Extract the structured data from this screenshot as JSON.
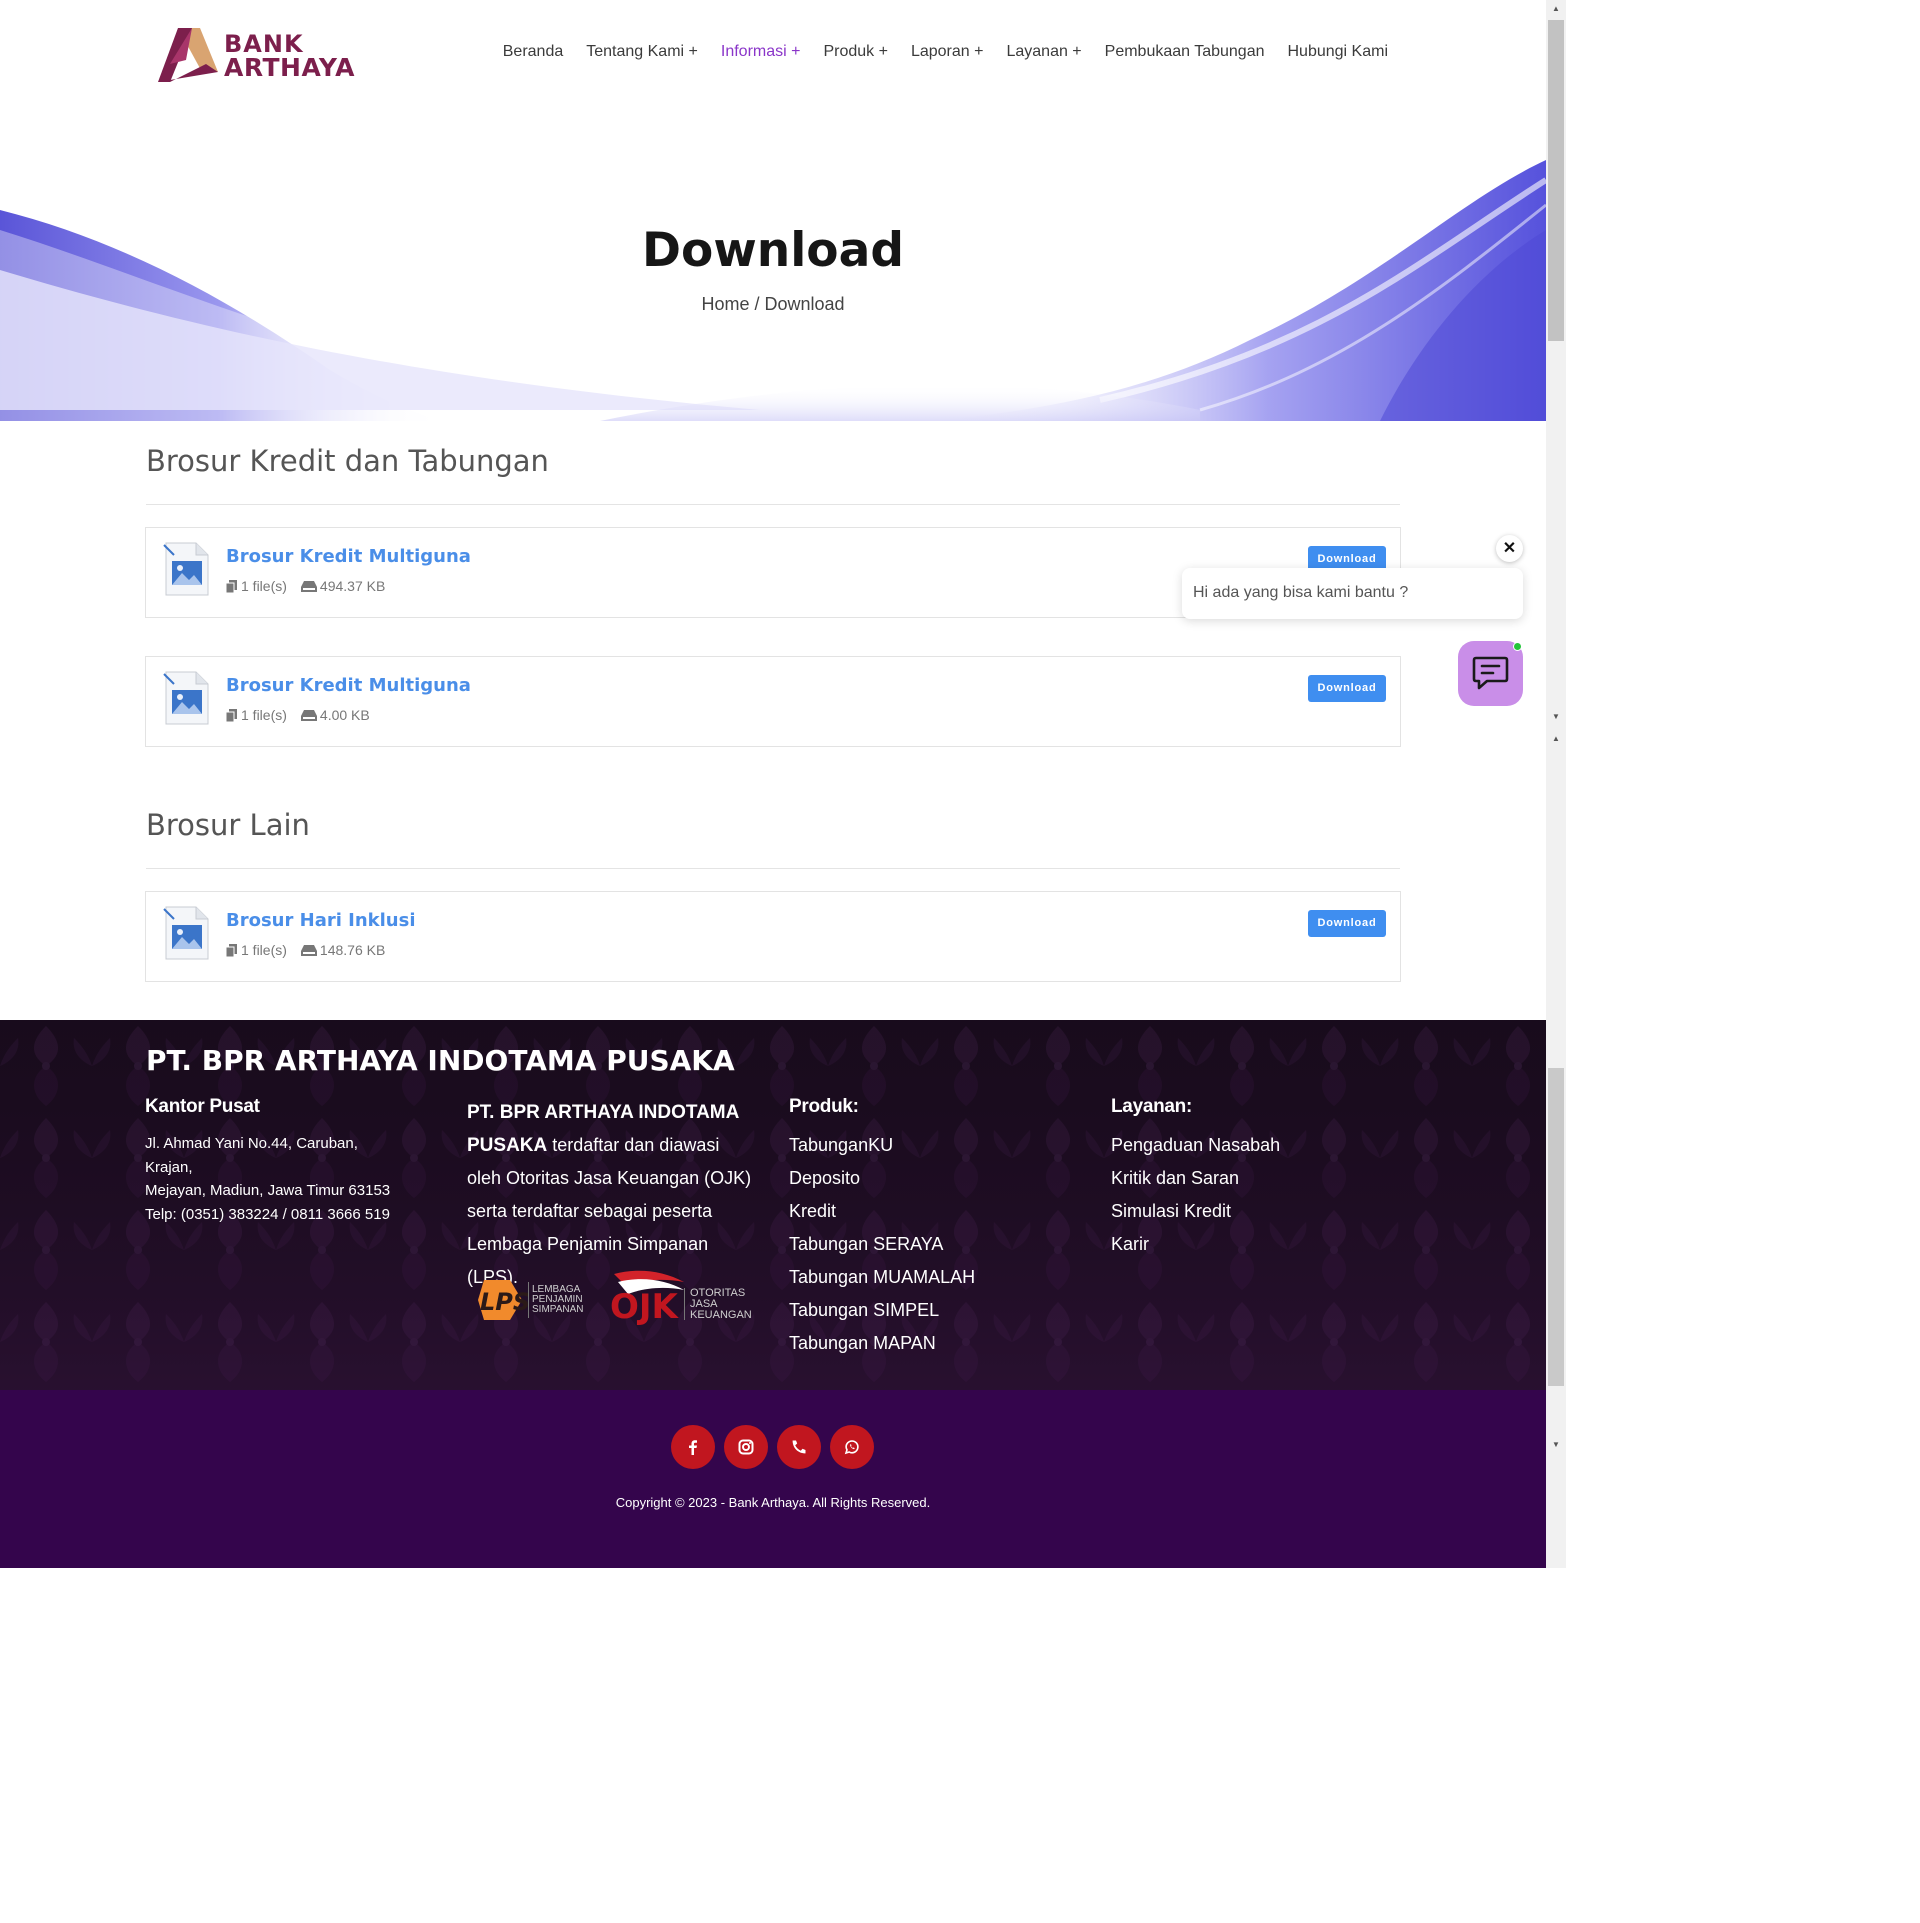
{
  "brand": {
    "line1": "BANK",
    "line2": "ARTHAYA"
  },
  "nav": [
    {
      "label": "Beranda",
      "active": false
    },
    {
      "label": "Tentang Kami +",
      "active": false
    },
    {
      "label": "Informasi +",
      "active": true
    },
    {
      "label": "Produk +",
      "active": false
    },
    {
      "label": "Laporan +",
      "active": false
    },
    {
      "label": "Layanan +",
      "active": false
    },
    {
      "label": "Pembukaan Tabungan",
      "active": false
    },
    {
      "label": "Hubungi Kami",
      "active": false
    }
  ],
  "hero": {
    "title": "Download",
    "breadcrumb_home": "Home",
    "breadcrumb_sep": " / ",
    "breadcrumb_current": "Download"
  },
  "sections": [
    {
      "title": "Brosur Kredit dan Tabungan",
      "files": [
        {
          "title": "Brosur Kredit Multiguna",
          "count": "1 file(s)",
          "size": "494.37 KB",
          "button": "Download"
        },
        {
          "title": "Brosur Kredit Multiguna",
          "count": "1 file(s)",
          "size": "4.00 KB",
          "button": "Download"
        }
      ]
    },
    {
      "title": "Brosur Lain",
      "files": [
        {
          "title": "Brosur Hari Inklusi",
          "count": "1 file(s)",
          "size": "148.76 KB",
          "button": "Download"
        }
      ]
    }
  ],
  "chat": {
    "close": "✕",
    "message": "Hi ada yang bisa kami bantu ?"
  },
  "footer": {
    "company": "PT. BPR ARTHAYA INDOTAMA PUSAKA",
    "office_heading": "Kantor Pusat",
    "address_line1": "Jl. Ahmad Yani No.44, Caruban, Krajan,",
    "address_line2": "Mejayan, Madiun, Jawa Timur 63153",
    "phone": "Telp: (0351) 383224 / 0811 3666 519",
    "ojk_company": "PT. BPR ARTHAYA INDOTAMA PUSAKA",
    "ojk_text": " terdaftar dan diawasi oleh Otoritas Jasa Keuangan (OJK) serta terdaftar sebagai peserta Lembaga Penjamin Simpanan (LPS).",
    "lps_logo": "LPS",
    "lps_label": [
      "LEMBAGA",
      "PENJAMIN",
      "SIMPANAN"
    ],
    "ojk_logo": "OJK",
    "ojk_label": [
      "OTORITAS",
      "JASA",
      "KEUANGAN"
    ],
    "products_heading": "Produk:",
    "products": [
      "TabunganKU",
      "Deposito",
      "Kredit",
      "Tabungan SERAYA",
      "Tabungan MUAMALAH",
      "Tabungan SIMPEL",
      "Tabungan MAPAN"
    ],
    "services_heading": "Layanan:",
    "services": [
      "Pengaduan Nasabah",
      "Kritik dan Saran",
      "Simulasi Kredit",
      "Karir"
    ],
    "socials": [
      "facebook-icon",
      "instagram-icon",
      "phone-icon",
      "whatsapp-icon"
    ],
    "copyright": "Copyright © 2023 - Bank Arthaya. All Rights Reserved."
  },
  "colors": {
    "accent": "#8a35c9",
    "link": "#4a8ee8",
    "button": "#3f8ef0",
    "footer_dark": "#1a0c1e",
    "footer_bottom": "#34054c",
    "social": "#c1161f",
    "brand": "#7c1f4c"
  }
}
